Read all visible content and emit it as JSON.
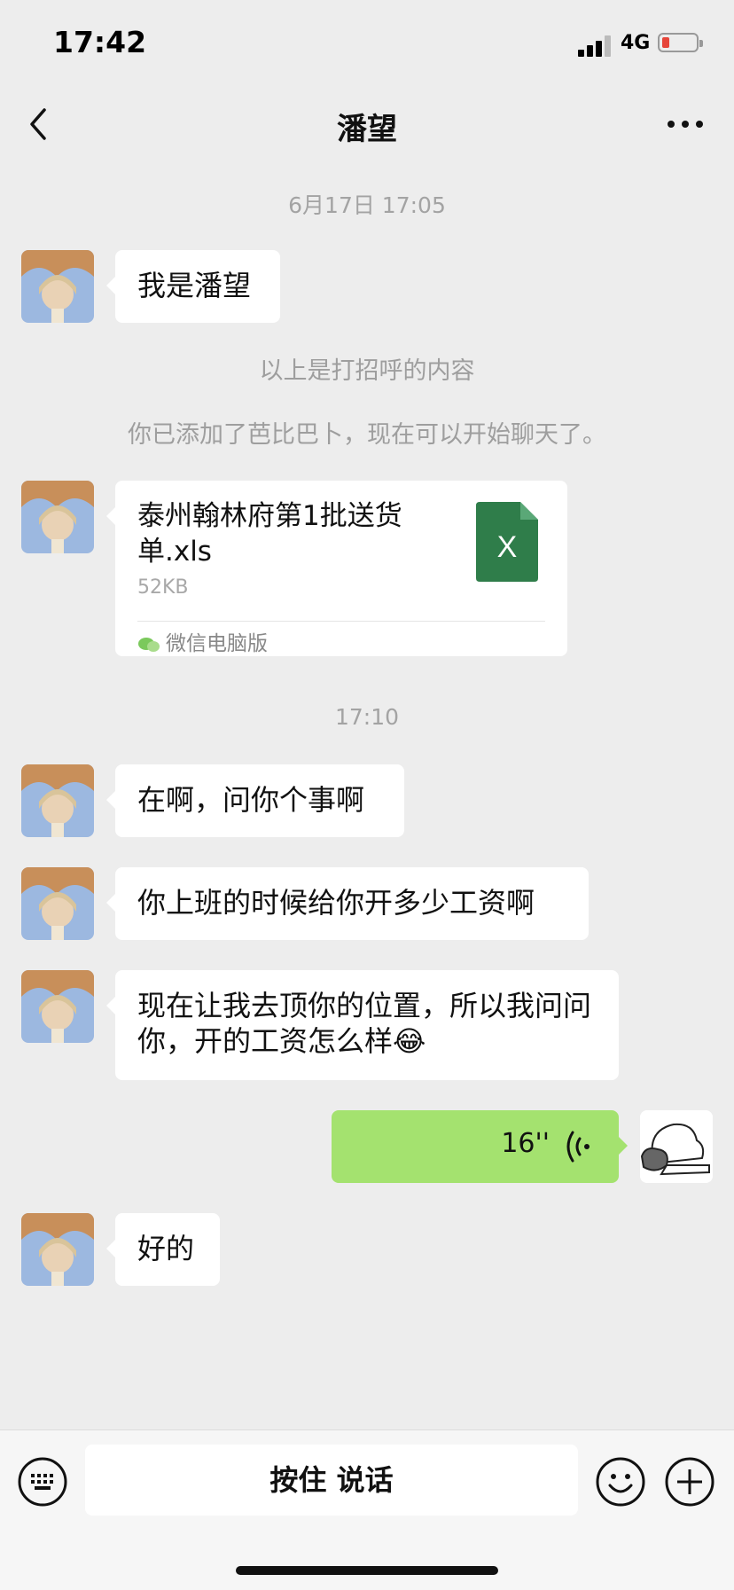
{
  "status_bar": {
    "time": "17:42",
    "network": "4G",
    "battery_color": "#e6453a"
  },
  "nav": {
    "title": "潘望"
  },
  "chat": {
    "timestamp_1": "6月17日 17:05",
    "msg_1": "我是潘望",
    "system_1": "以上是打招呼的内容",
    "system_2": "你已添加了芭比巴卜，现在可以开始聊天了。",
    "file": {
      "name": "泰州翰林府第1批送货单.xls",
      "size": "52KB",
      "source": "微信电脑版",
      "icon_letter": "X",
      "icon_color": "#2f7d4a"
    },
    "timestamp_2": "17:10",
    "msg_2": "在啊，问你个事啊",
    "msg_3": "你上班的时候给你开多少工资啊",
    "msg_4": "现在让我去顶你的位置，所以我问问你，开的工资怎么样",
    "msg_4_emoji": "😂",
    "voice": {
      "duration": "16''",
      "bubble_color": "#a4e26f"
    },
    "msg_5": "好的"
  },
  "input_bar": {
    "hold_to_talk": "按住 说话"
  }
}
